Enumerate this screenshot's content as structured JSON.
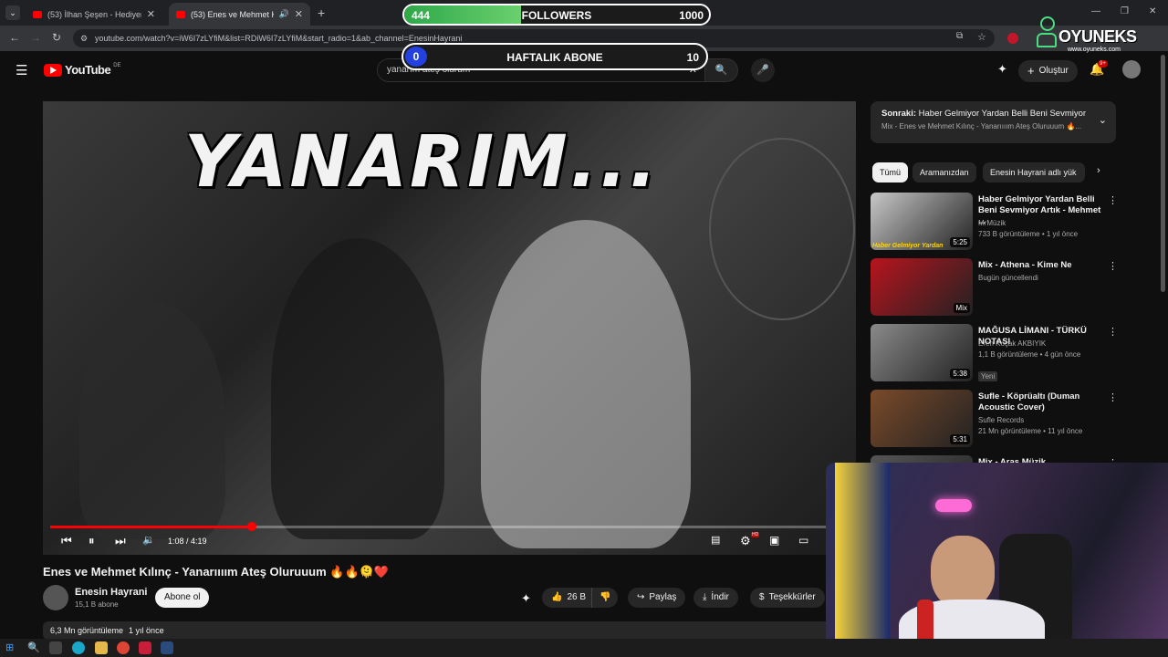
{
  "browser": {
    "tabs": [
      {
        "label": "(53) İlhan Şeşen - Hediyem (Al…",
        "active": false
      },
      {
        "label": "(53) Enes ve Mehmet Kılınç",
        "active": true
      }
    ],
    "new_tab_icon": "plus-icon",
    "url": "youtube.com/watch?v=iW6I7zLYfiM&list=RDiW6I7zLYfiM&start_radio=1&ab_channel=EnesinHayrani"
  },
  "overlay": {
    "followers": {
      "current": "444",
      "label": "FOLLOWERS",
      "goal": "1000",
      "fill_fraction": 0.44
    },
    "weekly": {
      "current": "0",
      "label": "HAFTALIK ABONE",
      "goal": "10",
      "fill_fraction": 0
    },
    "brand": "OYUNEKS",
    "brand_url": "www.oyuneks.com"
  },
  "youtube": {
    "logo": "YouTube",
    "region": "DE",
    "search_value": "yanarım ateş olurum",
    "create_label": "Oluştur",
    "notif_badge": "9+"
  },
  "player": {
    "overlay_title": "YANARIM...",
    "time": "1:08 / 4:19",
    "progress_fraction": 0.26,
    "hd_badge": "HD"
  },
  "video": {
    "title": "Enes ve Mehmet Kılınç - Yanarıııım Ateş Oluruuum 🔥🔥🫠❤️",
    "channel": "Enesin Hayrani",
    "subs": "15,1 B abone",
    "subscribe_label": "Abone ol",
    "likes": "26 B",
    "share_label": "Paylaş",
    "download_label": "İndir",
    "thanks_label": "Teşekkürler",
    "views": "6,3 Mn görüntüleme",
    "age": "1 yıl önce"
  },
  "sidebar": {
    "next": {
      "label": "Sonraki:",
      "title": "Haber Gelmiyor Yardan Belli Beni Sevmiyor ...",
      "sub": "Mix - Enes ve Mehmet Kılınç - Yanarıııım Ateş Oluruuum 🔥..."
    },
    "chips": [
      "Tümü",
      "Aramanızdan",
      "Enesin Hayrani adlı yük"
    ],
    "items": [
      {
        "title": "Haber Gelmiyor Yardan Belli Beni Sevmiyor Artık - Mehmet ...",
        "channel": "MrMüzik",
        "meta": "733 B görüntüleme • 1 yıl önce",
        "duration": "5:25",
        "thumb_caption": "Haber Gelmiyor Yardan",
        "thumb_color": "#c8c8c8"
      },
      {
        "title": "Mix - Athena - Kime Ne",
        "channel": "Bugün güncellendi",
        "meta": "",
        "duration": "Mix",
        "thumb_caption": "",
        "thumb_color": "#b8141e"
      },
      {
        "title": "MAĞUSA LİMANI - TÜRKÜ NOTASI",
        "channel": "Eren Koçak AKBIYIK",
        "meta": "1,1 B görüntüleme • 4 gün önce",
        "badge": "Yeni",
        "duration": "5:38",
        "thumb_caption": "",
        "thumb_color": "#8a8a8a"
      },
      {
        "title": "Sufle - Köprüaltı (Duman Acoustic Cover)",
        "channel": "Sufle Records",
        "meta": "21 Mn görüntüleme • 11 yıl önce",
        "duration": "5:31",
        "thumb_caption": "",
        "thumb_color": "#7a4a2a"
      },
      {
        "title": "Mix - Aras Müzik",
        "channel": "",
        "meta": "",
        "duration": "",
        "thumb_caption": "",
        "thumb_color": "#555555"
      }
    ]
  }
}
